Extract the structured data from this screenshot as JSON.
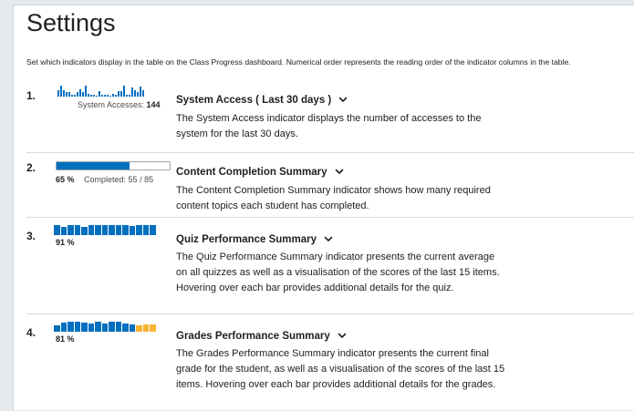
{
  "page": {
    "title": "Settings",
    "description": "Set which indicators display in the table on the Class Progress dashboard. Numerical order represents the reading order of the indicator columns in the table."
  },
  "colors": {
    "primary": "#006fbf",
    "warning": "#f9b335"
  },
  "icons": {
    "expand": "chevron-down-icon"
  },
  "indicators": [
    {
      "number": "1.",
      "name": "System Access ( Last 30 days )",
      "description": "The System Access indicator displays the number of accesses to the system for the last 30 days.",
      "metric_label": "System Accesses:",
      "metric_value": "144",
      "activity_levels": [
        5,
        9,
        5,
        3,
        3,
        1,
        1,
        3,
        6,
        3,
        9,
        2,
        1,
        1,
        0,
        4,
        1,
        1,
        1,
        0,
        2,
        1,
        4,
        4,
        9,
        1,
        1,
        7,
        5,
        3,
        8,
        5
      ]
    },
    {
      "number": "2.",
      "name": "Content Completion Summary",
      "description": "The Content Completion Summary indicator shows how many required content topics each student has completed.",
      "percent": "65 %",
      "completed_label": "Completed: 55 / 85",
      "completed": 55,
      "total": 85
    },
    {
      "number": "3.",
      "name": "Quiz Performance Summary",
      "description": "The Quiz Performance Summary indicator presents the current average on all quizzes as well as a visualisation of the scores of the last 15 items. Hovering over each bar provides additional details for the quiz.",
      "percent": "91 %",
      "scores": [
        1,
        0.85,
        1,
        1,
        0.8,
        1,
        1,
        1,
        1,
        1,
        1,
        0.9,
        1,
        1,
        1
      ]
    },
    {
      "number": "4.",
      "name": "Grades Performance Summary",
      "description": "The Grades Performance Summary indicator presents the current final grade for the student, as well as a visualisation of the scores of the last 15 items. Hovering over each bar provides additional details for the grades.",
      "percent": "81 %",
      "scores": [
        0.6,
        0.9,
        1,
        1,
        0.9,
        0.85,
        1,
        0.85,
        1,
        1,
        0.8,
        0.7,
        0.6,
        0.7,
        0.75
      ],
      "warning_from": 12
    }
  ]
}
